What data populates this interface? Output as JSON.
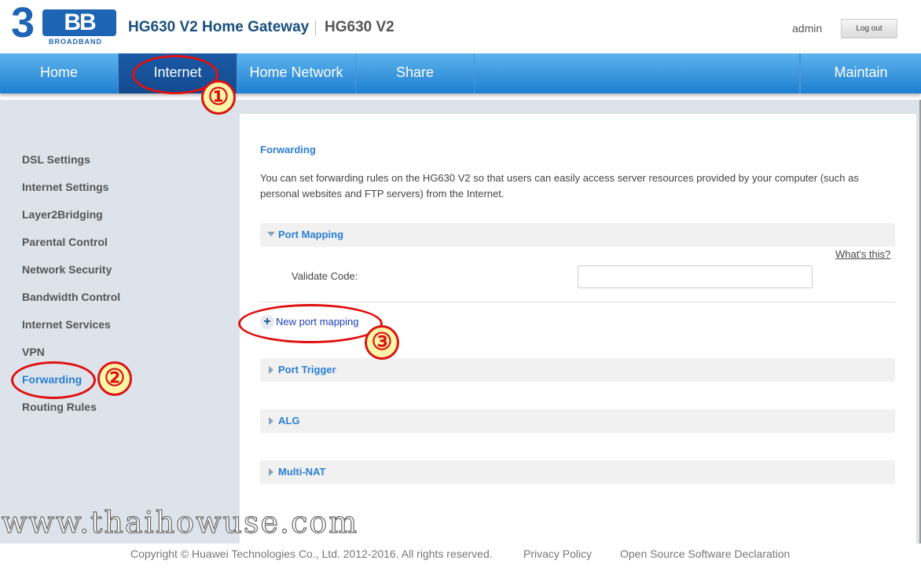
{
  "header": {
    "logo": {
      "brand": "3BB",
      "tagline": "BROADBAND"
    },
    "title": "HG630 V2 Home Gateway",
    "model": "HG630 V2",
    "user": "admin",
    "logout_label": "Log out"
  },
  "nav": {
    "items": [
      {
        "label": "Home"
      },
      {
        "label": "Internet",
        "active": true
      },
      {
        "label": "Home Network"
      },
      {
        "label": "Share"
      },
      {
        "label": "Maintain"
      }
    ]
  },
  "sidebar": {
    "items": [
      {
        "label": "DSL Settings"
      },
      {
        "label": "Internet Settings"
      },
      {
        "label": "Layer2Bridging"
      },
      {
        "label": "Parental Control"
      },
      {
        "label": "Network Security"
      },
      {
        "label": "Bandwidth Control"
      },
      {
        "label": "Internet Services"
      },
      {
        "label": "VPN"
      },
      {
        "label": "Forwarding",
        "active": true
      },
      {
        "label": "Routing Rules"
      }
    ]
  },
  "main": {
    "title": "Forwarding",
    "description": "You can set forwarding rules on the HG630 V2 so that users can easily access server resources provided by your computer (such as personal websites and FTP servers) from the Internet.",
    "sections": [
      {
        "label": "Port Mapping",
        "expanded": true
      },
      {
        "label": "Port Trigger",
        "expanded": false
      },
      {
        "label": "ALG",
        "expanded": false
      },
      {
        "label": "Multi-NAT",
        "expanded": false
      }
    ],
    "whats_this": "What's this?",
    "validate_label": "Validate Code:",
    "validate_value": "",
    "new_mapping_label": "New port mapping"
  },
  "annotations": {
    "badges": [
      "①",
      "②",
      "③"
    ]
  },
  "watermark": "www.thaihowuse.com",
  "footer": {
    "copyright": "Copyright © Huawei Technologies Co., Ltd. 2012-2016. All rights reserved.",
    "privacy": "Privacy Policy",
    "oss": "Open Source Software Declaration"
  },
  "colors": {
    "nav_gradient_top": "#5db3ec",
    "nav_gradient_bottom": "#1e7ed0",
    "nav_active": "#134a8e",
    "accent_blue": "#2a7fd4",
    "annotation_red": "#e01010",
    "badge_fill": "#fff6a8"
  }
}
